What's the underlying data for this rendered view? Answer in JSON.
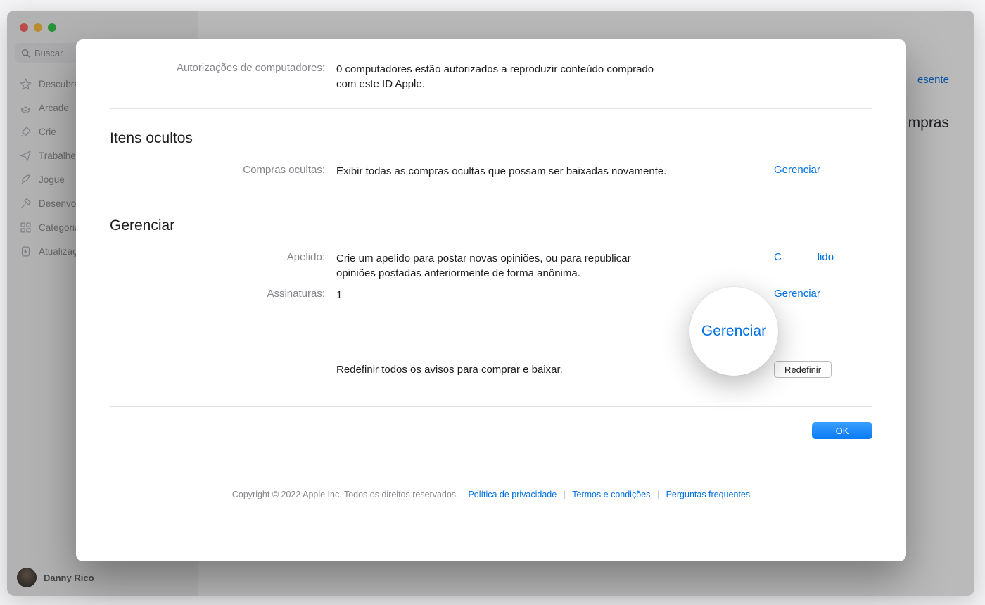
{
  "sidebar": {
    "search_placeholder": "Buscar",
    "items": [
      {
        "label": "Descubra",
        "icon": "star"
      },
      {
        "label": "Arcade",
        "icon": "arcade"
      },
      {
        "label": "Crie",
        "icon": "brush"
      },
      {
        "label": "Trabalhe",
        "icon": "paperplane"
      },
      {
        "label": "Jogue",
        "icon": "rocket"
      },
      {
        "label": "Desenvolva",
        "icon": "hammer"
      },
      {
        "label": "Categorias",
        "icon": "grid"
      },
      {
        "label": "Atualizações",
        "icon": "download"
      }
    ],
    "user_name": "Danny Rico"
  },
  "background": {
    "gift_link": "esente",
    "purchases_heading": "mpras"
  },
  "modal": {
    "authorizations": {
      "label": "Autorizações de computadores:",
      "value": "0 computadores estão autorizados a reproduzir conteúdo comprado com este ID Apple."
    },
    "hidden_section": {
      "title": "Itens ocultos",
      "purchases_label": "Compras ocultas:",
      "purchases_value": "Exibir todas as compras ocultas que possam ser baixadas novamente.",
      "manage_link": "Gerenciar"
    },
    "manage_section": {
      "title": "Gerenciar",
      "nickname_label": "Apelido:",
      "nickname_value": "Crie um apelido para postar novas opiniões, ou para republicar opiniões postadas anteriormente de forma anônima.",
      "nickname_action_partial": "C... ...lido",
      "subs_label": "Assinaturas:",
      "subs_value": "1",
      "subs_action": "Gerenciar"
    },
    "reset": {
      "text": "Redefinir todos os avisos para comprar e baixar.",
      "button": "Redefinir"
    },
    "ok_button": "OK",
    "legal": {
      "copyright": "Copyright © 2022 Apple Inc. Todos os direitos reservados.",
      "privacy": "Política de privacidade",
      "terms": "Termos e condições",
      "faq": "Perguntas frequentes"
    }
  },
  "magnifier_label": "Gerenciar"
}
